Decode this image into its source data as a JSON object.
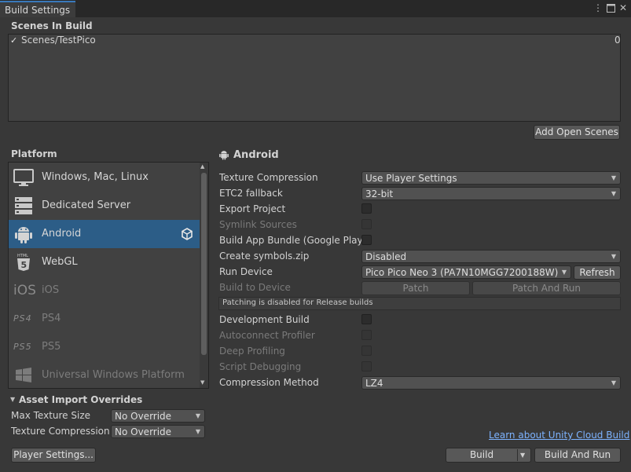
{
  "window": {
    "tab_title": "Build Settings",
    "icons": [
      "more-options-icon",
      "maximize-icon",
      "close-icon"
    ]
  },
  "scenes": {
    "title": "Scenes In Build",
    "items": [
      {
        "checked": true,
        "name": "Scenes/TestPico",
        "index": "0"
      }
    ],
    "add_open_scenes": "Add Open Scenes"
  },
  "platform": {
    "title": "Platform",
    "items": [
      {
        "label": "Windows, Mac, Linux",
        "icon": "monitor-icon",
        "selected": false,
        "enabled": true
      },
      {
        "label": "Dedicated Server",
        "icon": "server-icon",
        "selected": false,
        "enabled": true
      },
      {
        "label": "Android",
        "icon": "android-icon",
        "selected": true,
        "enabled": true
      },
      {
        "label": "WebGL",
        "icon": "html5-icon",
        "selected": false,
        "enabled": true
      },
      {
        "label": "iOS",
        "icon": "ios-icon",
        "selected": false,
        "enabled": false
      },
      {
        "label": "PS4",
        "icon": "ps4-icon",
        "selected": false,
        "enabled": false
      },
      {
        "label": "PS5",
        "icon": "ps5-icon",
        "selected": false,
        "enabled": false
      },
      {
        "label": "Universal Windows Platform",
        "icon": "windows-icon",
        "selected": false,
        "enabled": false
      }
    ]
  },
  "android": {
    "title": "Android",
    "texture_compression": {
      "label": "Texture Compression",
      "value": "Use Player Settings"
    },
    "etc2_fallback": {
      "label": "ETC2 fallback",
      "value": "32-bit"
    },
    "export_project": {
      "label": "Export Project",
      "checked": false
    },
    "symlink_sources": {
      "label": "Symlink Sources",
      "checked": false,
      "enabled": false
    },
    "build_app_bundle": {
      "label": "Build App Bundle (Google Play)",
      "checked": false
    },
    "create_symbols": {
      "label": "Create symbols.zip",
      "value": "Disabled"
    },
    "run_device": {
      "label": "Run Device",
      "value": "Pico Pico Neo 3 (PA7N10MGG7200188W)",
      "refresh": "Refresh"
    },
    "build_to_device": {
      "label": "Build to Device",
      "patch": "Patch",
      "patch_and_run": "Patch And Run"
    },
    "patching_info": "Patching is disabled for Release builds",
    "development_build": {
      "label": "Development Build",
      "checked": false
    },
    "autoconnect_profiler": {
      "label": "Autoconnect Profiler",
      "checked": false,
      "enabled": false
    },
    "deep_profiling": {
      "label": "Deep Profiling",
      "checked": false,
      "enabled": false
    },
    "script_debugging": {
      "label": "Script Debugging",
      "checked": false,
      "enabled": false
    },
    "compression_method": {
      "label": "Compression Method",
      "value": "LZ4"
    }
  },
  "asset_import_overrides": {
    "title": "Asset Import Overrides",
    "max_texture_size": {
      "label": "Max Texture Size",
      "value": "No Override"
    },
    "texture_compression": {
      "label": "Texture Compression",
      "value": "No Override"
    }
  },
  "footer": {
    "cloud_build_link": "Learn about Unity Cloud Build",
    "player_settings": "Player Settings...",
    "build": "Build",
    "build_and_run": "Build And Run"
  },
  "colors": {
    "background": "#383838",
    "selection": "#2c5d87",
    "accent": "#3a79bb",
    "link": "#7db3ff"
  }
}
